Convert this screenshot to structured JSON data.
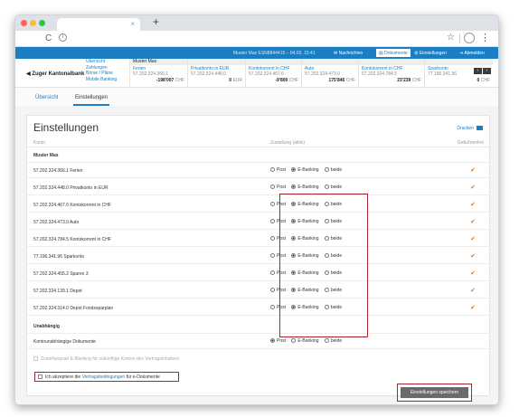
{
  "browser": {
    "new_tab": "+",
    "reload": "C",
    "info": "i",
    "star": "☆",
    "menu": "⋮",
    "tab_close": "×"
  },
  "topbar": {
    "user": "Muster Max   ESN8844415 – 04.03. 15:41",
    "messages": "Nachrichten",
    "documents": "Dokumente",
    "settings": "Einstellungen",
    "logout": "Abmelden"
  },
  "bank": {
    "logo": "Zuger Kantonalbank",
    "quick_links": [
      "Übersicht",
      "Zahlungen",
      "Börse / Pläne",
      "Mobile Banking"
    ],
    "user_bar": "Muster Max"
  },
  "accounts": [
    {
      "name": "Ferien",
      "number": "57.202.324.366.1",
      "amount": "-198'007",
      "currency": "CHF"
    },
    {
      "name": "Privatkonto in EUR",
      "number": "57.202.324.448.0",
      "amount": "0",
      "currency": "EUR"
    },
    {
      "name": "Kontokorrent in CHF",
      "number": "57.202.324.467.6",
      "amount": "-9'800",
      "currency": "CHF"
    },
    {
      "name": "Auto",
      "number": "57.202.324.473.0",
      "amount": "175'846",
      "currency": "CHF"
    },
    {
      "name": "Kontokorrent in CHF",
      "number": "57.202.324.784.5",
      "amount": "23'239",
      "currency": "CHF"
    },
    {
      "name": "Sparkonto",
      "number": "77.196.341.96",
      "amount": "0",
      "currency": "CHF"
    }
  ],
  "subnav": {
    "overview": "Übersicht",
    "settings": "Einstellungen"
  },
  "page": {
    "title": "Einstellungen",
    "print": "Drucken",
    "col_account": "Konto",
    "col_delivery": "Zustellung (aktiv)",
    "col_fee": "Gebührenfrei"
  },
  "radio_labels": {
    "post": "Post",
    "ebanking": "E-Banking",
    "both": "beide"
  },
  "group1": "Muster Max",
  "rows": [
    {
      "label": "57.202.324.366.1 Ferien"
    },
    {
      "label": "57.202.324.448.0 Privatkonto in EUR"
    },
    {
      "label": "57.202.324.467.6 Kontokorrent in CHF"
    },
    {
      "label": "57.202.324.473.0 Auto"
    },
    {
      "label": "57.202.324.784.5 Kontokorrent in CHF"
    },
    {
      "label": "77.196.341.96 Sparkonto"
    },
    {
      "label": "57.202.324.455.2 Sparen 3"
    },
    {
      "label": "57.202.324.139.1 Depot"
    },
    {
      "label": "57.202.324.314.0 Depot Fondssparplan"
    }
  ],
  "group2": "Unabhängig",
  "independent_row": "Kontounabhängige Dokumente",
  "hint": "Zustellungsart E-Banking für zukünftige Konten des Vertragsinhabers",
  "accept": {
    "prefix": "Ich akzeptiere die ",
    "link": "Vertragsbedingungen",
    "suffix": " für e-Dokumente"
  },
  "save": "Einstellungen speichern",
  "colors": {
    "accent": "#1b7ec2",
    "highlight": "#a8242e",
    "check": "#e87a1e"
  }
}
